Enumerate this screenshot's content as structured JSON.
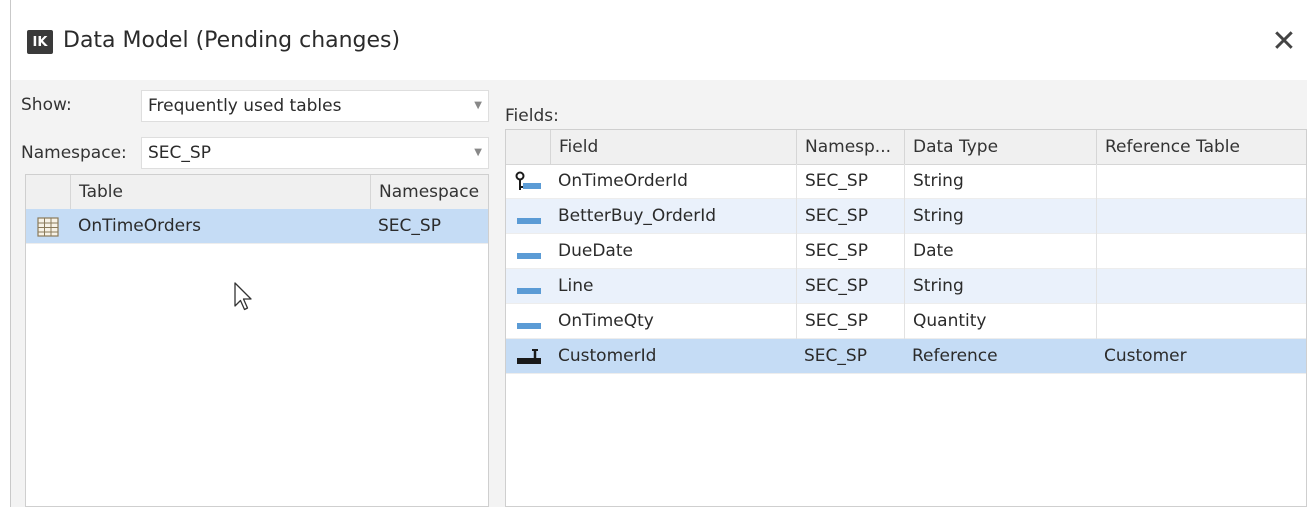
{
  "window": {
    "title": "Data Model (Pending changes)",
    "logo_text": "IK",
    "close_glyph": "✕"
  },
  "left": {
    "show_label": "Show:",
    "show_value": "Frequently used tables",
    "namespace_label": "Namespace:",
    "namespace_value": "SEC_SP",
    "table": {
      "headers": {
        "table": "Table",
        "namespace": "Namespace"
      },
      "rows": [
        {
          "table": "OnTimeOrders",
          "namespace": "SEC_SP",
          "icon": "table-grid-icon",
          "selected": true
        }
      ]
    }
  },
  "right": {
    "fields_label": "Fields:",
    "table": {
      "headers": {
        "field": "Field",
        "namespace": "Namesp...",
        "data_type": "Data Type",
        "reference_table": "Reference Table"
      },
      "rows": [
        {
          "icon": "key-field-icon",
          "field": "OnTimeOrderId",
          "namespace": "SEC_SP",
          "data_type": "String",
          "reference_table": ""
        },
        {
          "icon": "field-icon",
          "field": "BetterBuy_OrderId",
          "namespace": "SEC_SP",
          "data_type": "String",
          "reference_table": ""
        },
        {
          "icon": "field-icon",
          "field": "DueDate",
          "namespace": "SEC_SP",
          "data_type": "Date",
          "reference_table": ""
        },
        {
          "icon": "field-icon",
          "field": "Line",
          "namespace": "SEC_SP",
          "data_type": "String",
          "reference_table": ""
        },
        {
          "icon": "field-icon",
          "field": "OnTimeQty",
          "namespace": "SEC_SP",
          "data_type": "Quantity",
          "reference_table": ""
        },
        {
          "icon": "reference-field-icon",
          "field": "CustomerId",
          "namespace": "SEC_SP",
          "data_type": "Reference",
          "reference_table": "Customer"
        }
      ]
    }
  },
  "colors": {
    "selection": "#c5dcf5",
    "alt_row": "#eaf1fb",
    "field_icon": "#5b9bd5"
  }
}
